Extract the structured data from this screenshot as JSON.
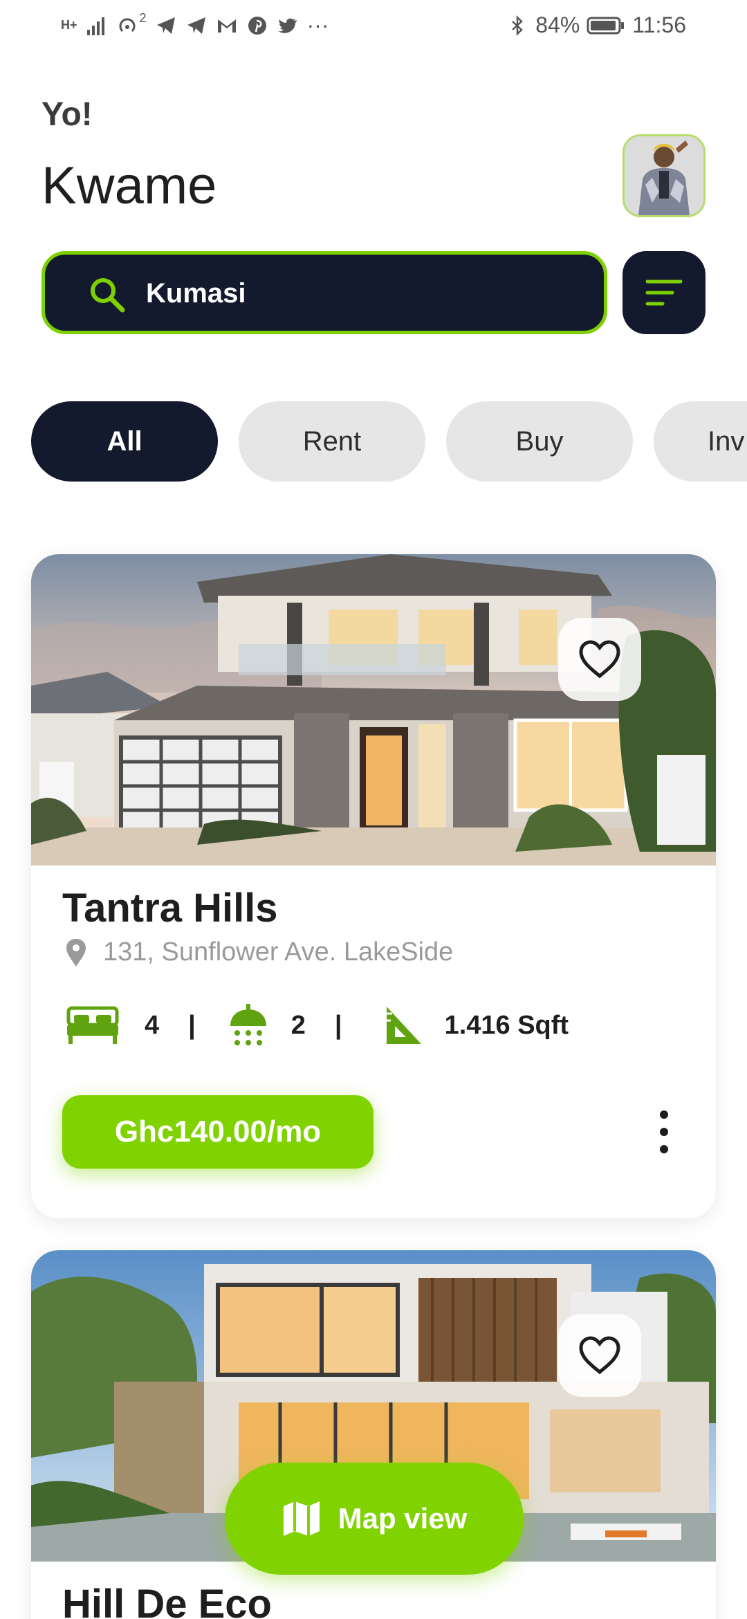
{
  "status_bar": {
    "network_label": "H+",
    "hotspot_count": "2",
    "more_dots": "···",
    "battery_percent": "84%",
    "time": "11:56"
  },
  "header": {
    "greeting": "Yo!",
    "name": "Kwame"
  },
  "search": {
    "value": "Kumasi"
  },
  "tabs": [
    {
      "label": "All",
      "active": true
    },
    {
      "label": "Rent",
      "active": false
    },
    {
      "label": "Buy",
      "active": false
    },
    {
      "label": "Inv",
      "active": false
    }
  ],
  "listings": [
    {
      "title": "Tantra Hills",
      "address": "131, Sunflower Ave. LakeSide",
      "bedrooms": "4",
      "bathrooms": "2",
      "area": "1.416 Sqft",
      "price": "Ghc140.00/mo",
      "separator": "|"
    },
    {
      "title": "Hill De Eco"
    }
  ],
  "map_button": {
    "label": "Map view"
  },
  "colors": {
    "accent_green": "#80d200",
    "dark_navy": "#141a2e",
    "tab_inactive": "#e6e6e6"
  },
  "icons": [
    "search-icon",
    "filter-icon",
    "heart-icon",
    "location-pin-icon",
    "bed-icon",
    "shower-icon",
    "area-ruler-icon",
    "more-vertical-icon",
    "map-icon"
  ]
}
